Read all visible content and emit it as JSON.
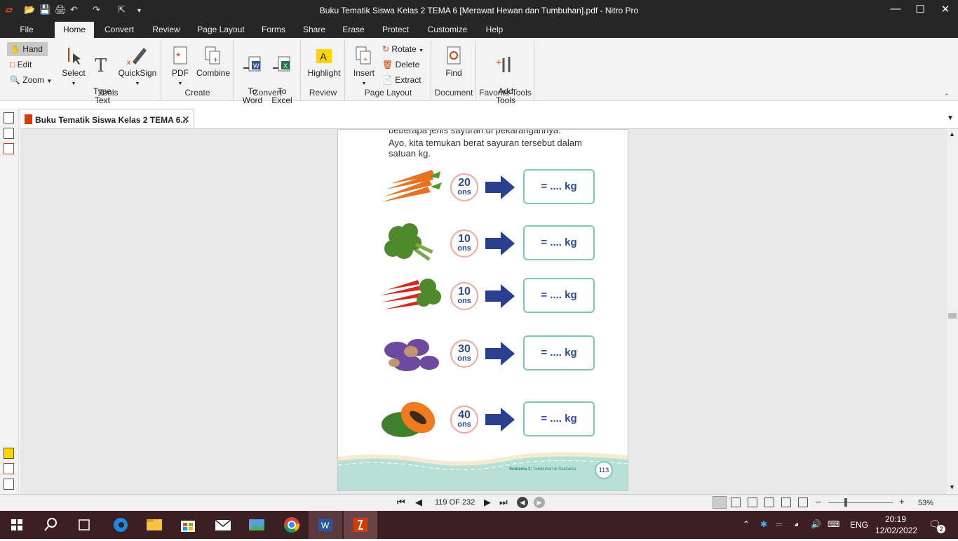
{
  "window": {
    "title": "Buku Tematik Siswa Kelas 2 TEMA 6 [Merawat Hewan dan Tumbuhan].pdf - Nitro Pro"
  },
  "menu": [
    "File",
    "Home",
    "Convert",
    "Review",
    "Page Layout",
    "Forms",
    "Share",
    "Erase",
    "Protect",
    "Customize",
    "Help"
  ],
  "ribbon": {
    "nav": {
      "hand": "Hand",
      "edit": "Edit",
      "zoom": "Zoom"
    },
    "tools": {
      "select": "Select",
      "type_text": "Type\nText",
      "quicksign": "QuickSign",
      "label": "Tools"
    },
    "create": {
      "pdf": "PDF",
      "combine": "Combine",
      "label": "Create"
    },
    "convert": {
      "to_word": "To\nWord",
      "to_excel": "To\nExcel",
      "label": "Convert"
    },
    "review": {
      "highlight": "Highlight",
      "label": "Review"
    },
    "page_layout": {
      "insert": "Insert",
      "rotate": "Rotate",
      "delete": "Delete",
      "extract": "Extract",
      "label": "Page Layout"
    },
    "document": {
      "find": "Find",
      "label": "Document"
    },
    "favorite": {
      "add_tools": "Add\nTools",
      "label": "Favorite Tools"
    }
  },
  "doc_tab": {
    "title": "Buku Tematik Siswa Kelas 2 TEMA 6..."
  },
  "page": {
    "line0": "beberapa jenis sayuran di pekarangannya.",
    "line1": "Ayo, kita temukan berat sayuran tersebut dalam",
    "line2": "satuan kg.",
    "unit": "ons",
    "answer": "= .... kg",
    "rows": [
      {
        "value": "20",
        "veg": "carrots"
      },
      {
        "value": "10",
        "veg": "broccoli"
      },
      {
        "value": "10",
        "veg": "chili"
      },
      {
        "value": "30",
        "veg": "sweet-potato"
      },
      {
        "value": "40",
        "veg": "papaya"
      }
    ],
    "footer": {
      "subtema": "Subtema 3:",
      "subtitle": "Tumbuhan di Sekitarku",
      "page_no": "113"
    }
  },
  "status": {
    "page": "119 OF 232",
    "zoom": "53%"
  },
  "taskbar": {
    "lang": "ENG",
    "time": "20:19",
    "date": "12/02/2022",
    "notif": "2"
  },
  "colors": {
    "accent": "#d83b01",
    "ribbon_bg": "#f3f3f3",
    "title_bg": "#262626",
    "taskbar": "#3c1f22",
    "ons_border": "#f0a99c",
    "box_border": "#7ccbb0",
    "text_blue": "#2e4a9a"
  }
}
